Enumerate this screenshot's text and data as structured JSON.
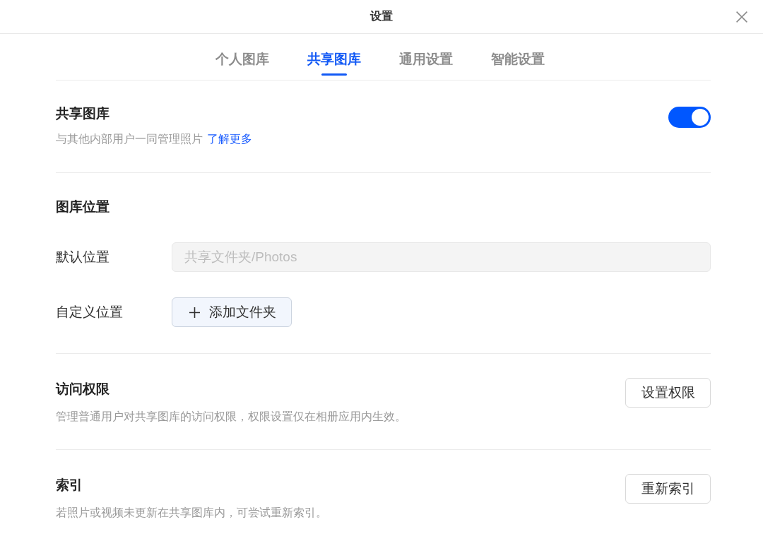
{
  "window": {
    "title": "设置"
  },
  "tabs": [
    {
      "label": "个人图库",
      "selected": false
    },
    {
      "label": "共享图库",
      "selected": true
    },
    {
      "label": "通用设置",
      "selected": false
    },
    {
      "label": "智能设置",
      "selected": false
    }
  ],
  "sections": [
    {
      "kind": "toggle",
      "title": "共享图库",
      "description": "与其他内部用户一同管理照片",
      "link": "了解更多",
      "on": true
    },
    {
      "kind": "location",
      "title": "图库位置",
      "rows": [
        {
          "kind": "field",
          "label": "默认位置",
          "value": "共享文件夹/Photos",
          "disabled": true
        },
        {
          "kind": "add",
          "label": "自定义位置",
          "button": "添加文件夹"
        }
      ]
    },
    {
      "kind": "action",
      "title": "访问权限",
      "description": "管理普通用户对共享图库的访问权限，权限设置仅在相册应用内生效。",
      "button": "设置权限"
    },
    {
      "kind": "action",
      "title": "索引",
      "description": "若照片或视频未更新在共享图库内，可尝试重新索引。",
      "button": "重新索引"
    }
  ]
}
